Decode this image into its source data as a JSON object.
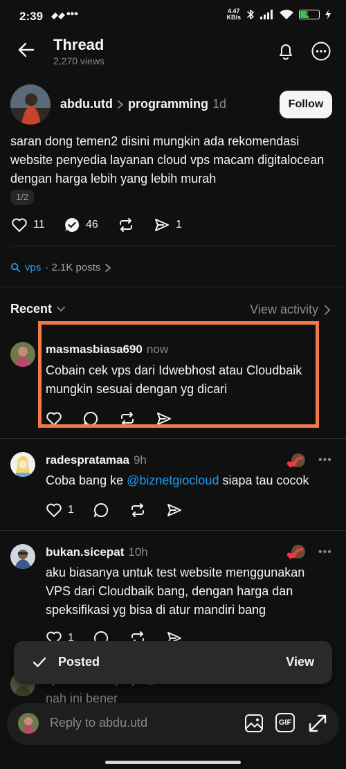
{
  "status_bar": {
    "time": "2:39",
    "net_speed_value": "4.47",
    "net_speed_unit": "KB/s",
    "battery": "43"
  },
  "header": {
    "title": "Thread",
    "views": "2,270 views"
  },
  "post": {
    "username": "abdu.utd",
    "topic": "programming",
    "time": "1d",
    "follow_label": "Follow",
    "text": "saran dong temen2 disini mungkin ada rekomendasi website penyedia layanan cloud vps macam digitalocean dengan harga lebih yang lebih murah",
    "page_indicator": "1/2",
    "likes": "11",
    "replies": "46",
    "shares": "1"
  },
  "topic_link": {
    "tag": "vps",
    "count": "· 2.1K posts"
  },
  "sort": {
    "label": "Recent",
    "view_activity": "View activity"
  },
  "replies": [
    {
      "username": "masmasbiasa690",
      "time": "now",
      "text": "Cobain cek vps dari Idwebhost atau Cloudbaik mungkin sesuai dengan yg dicari"
    },
    {
      "username": "radespratamaa",
      "time": "9h",
      "text_before": "Coba bang ke ",
      "mention": "@biznetgiocloud",
      "text_after": " siapa tau cocok",
      "likes": "1"
    },
    {
      "username": "bukan.sicepat",
      "time": "10h",
      "text": "aku biasanya untuk test website menggunakan VPS dari Cloudbaik bang, dengan harga dan speksifikasi yg bisa di atur mandiri bang",
      "likes": "1"
    },
    {
      "username": "ajudanmudapaijo",
      "time": "11h",
      "text": "nah ini bener"
    }
  ],
  "toast": {
    "label": "Posted",
    "action": "View"
  },
  "composer": {
    "placeholder": "Reply to abdu.utd",
    "gif_label": "GIF"
  },
  "colors": {
    "background": "#101010",
    "highlight": "#f07a4a",
    "link": "#1f9bf0",
    "battery": "#2ecc4f"
  }
}
